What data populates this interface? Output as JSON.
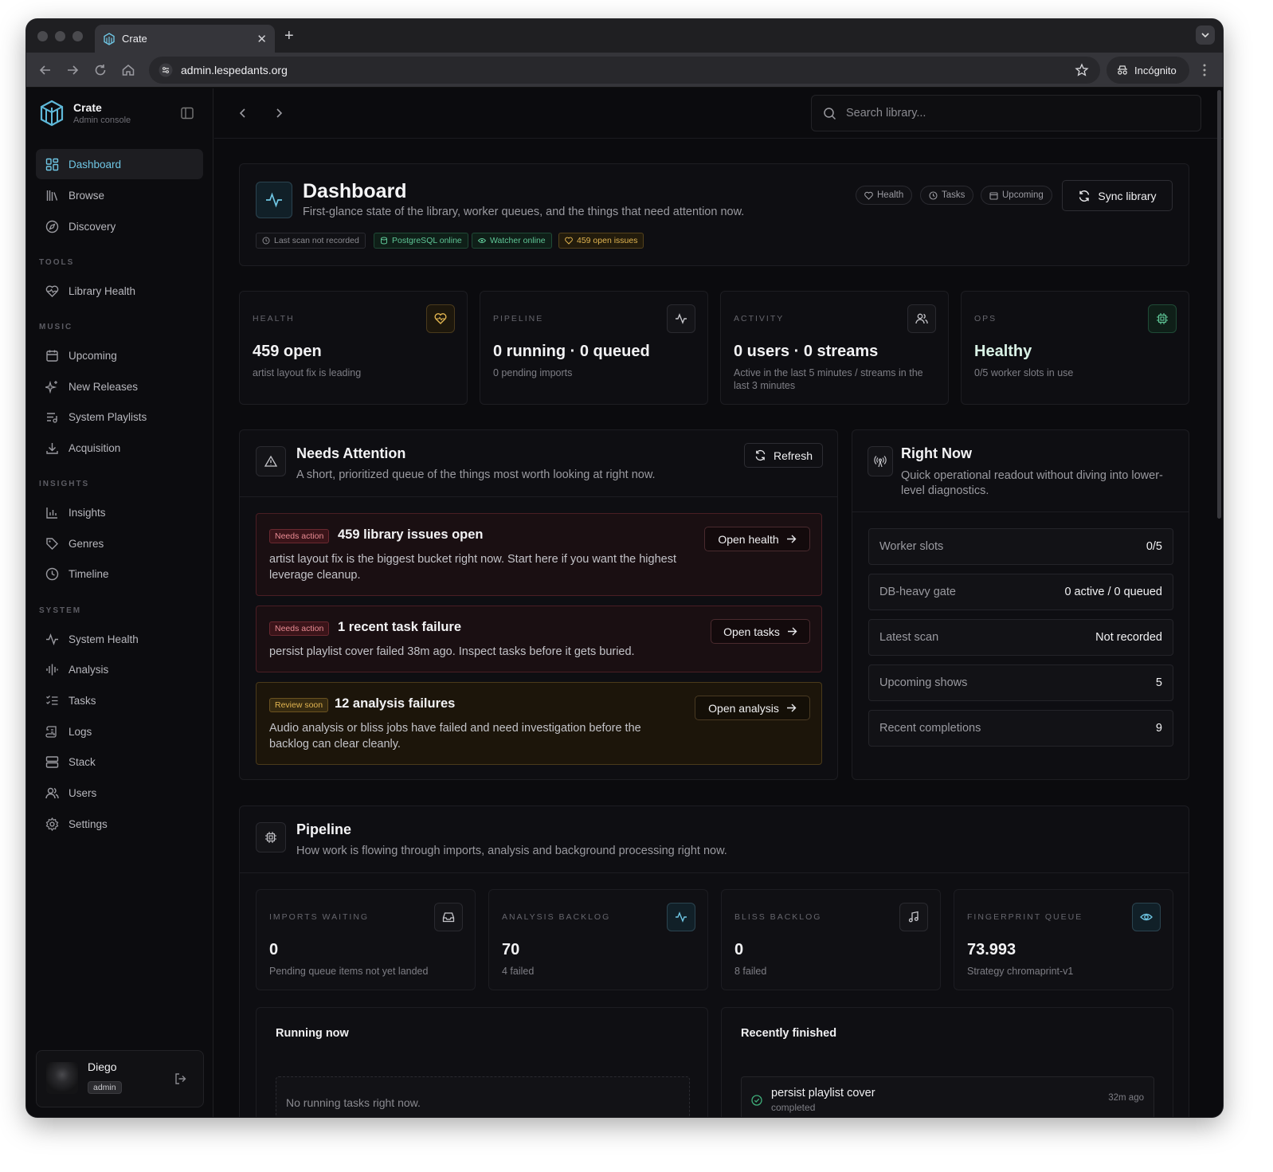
{
  "browser": {
    "tab_title": "Crate",
    "url": "admin.lespedants.org",
    "incognito_label": "Incógnito"
  },
  "sidebar": {
    "brand_name": "Crate",
    "brand_sub": "Admin console",
    "items_top": [
      {
        "label": "Dashboard",
        "icon": "grid-icon",
        "active": true
      },
      {
        "label": "Browse",
        "icon": "library-icon"
      },
      {
        "label": "Discovery",
        "icon": "compass-icon"
      }
    ],
    "sections": [
      {
        "title": "TOOLS",
        "items": [
          {
            "label": "Library Health",
            "icon": "heart-pulse-icon"
          }
        ]
      },
      {
        "title": "MUSIC",
        "items": [
          {
            "label": "Upcoming",
            "icon": "calendar-icon"
          },
          {
            "label": "New Releases",
            "icon": "sparkles-icon"
          },
          {
            "label": "System Playlists",
            "icon": "playlist-icon"
          },
          {
            "label": "Acquisition",
            "icon": "download-icon"
          }
        ]
      },
      {
        "title": "INSIGHTS",
        "items": [
          {
            "label": "Insights",
            "icon": "bar-chart-icon"
          },
          {
            "label": "Genres",
            "icon": "tag-icon"
          },
          {
            "label": "Timeline",
            "icon": "clock-icon"
          }
        ]
      },
      {
        "title": "SYSTEM",
        "items": [
          {
            "label": "System Health",
            "icon": "activity-icon"
          },
          {
            "label": "Analysis",
            "icon": "waveform-icon"
          },
          {
            "label": "Tasks",
            "icon": "list-checks-icon"
          },
          {
            "label": "Logs",
            "icon": "scroll-icon"
          },
          {
            "label": "Stack",
            "icon": "server-icon"
          },
          {
            "label": "Users",
            "icon": "users-icon"
          },
          {
            "label": "Settings",
            "icon": "gear-icon"
          }
        ]
      }
    ],
    "user": {
      "name": "Diego",
      "role": "admin"
    }
  },
  "topbar": {
    "search_placeholder": "Search library..."
  },
  "header": {
    "title": "Dashboard",
    "subtitle": "First-glance state of the library, worker queues, and the things that need attention now.",
    "pills": [
      "Health",
      "Tasks",
      "Upcoming"
    ],
    "sync_label": "Sync library",
    "chips": [
      {
        "label": "Last scan not recorded",
        "tone": "neutral"
      },
      {
        "label": "PostgreSQL online",
        "tone": "green"
      },
      {
        "label": "Watcher online",
        "tone": "green"
      },
      {
        "label": "459 open issues",
        "tone": "amber"
      }
    ]
  },
  "stats": [
    {
      "label": "HEALTH",
      "value": "459 open",
      "sub": "artist layout fix is leading",
      "icon": "heart-icon"
    },
    {
      "label": "PIPELINE",
      "value": "0 running · 0 queued",
      "sub": "0 pending imports",
      "icon": "activity-icon"
    },
    {
      "label": "ACTIVITY",
      "value": "0 users · 0 streams",
      "sub": "Active in the last 5 minutes / streams in the last 3 minutes",
      "icon": "users-icon"
    },
    {
      "label": "OPS",
      "value": "Healthy",
      "sub": "0/5 worker slots in use",
      "icon": "cpu-icon"
    }
  ],
  "attention": {
    "title": "Needs Attention",
    "subtitle": "A short, prioritized queue of the things most worth looking at right now.",
    "refresh_label": "Refresh",
    "items": [
      {
        "badge": "Needs action",
        "title": "459 library issues open",
        "desc": "artist layout fix is the biggest bucket right now. Start here if you want the highest leverage cleanup.",
        "action": "Open health",
        "tone": "red"
      },
      {
        "badge": "Needs action",
        "title": "1 recent task failure",
        "desc": "persist playlist cover failed 38m ago. Inspect tasks before it gets buried.",
        "action": "Open tasks",
        "tone": "red"
      },
      {
        "badge": "Review soon",
        "title": "12 analysis failures",
        "desc": "Audio analysis or bliss jobs have failed and need investigation before the backlog can clear cleanly.",
        "action": "Open analysis",
        "tone": "amber"
      }
    ]
  },
  "right_now": {
    "title": "Right Now",
    "subtitle": "Quick operational readout without diving into lower-level diagnostics.",
    "rows": [
      {
        "key": "Worker slots",
        "value": "0/5"
      },
      {
        "key": "DB-heavy gate",
        "value": "0 active / 0 queued"
      },
      {
        "key": "Latest scan",
        "value": "Not recorded"
      },
      {
        "key": "Upcoming shows",
        "value": "5"
      },
      {
        "key": "Recent completions",
        "value": "9"
      }
    ]
  },
  "pipeline": {
    "title": "Pipeline",
    "subtitle": "How work is flowing through imports, analysis and background processing right now.",
    "stats": [
      {
        "label": "IMPORTS WAITING",
        "value": "0",
        "sub": "Pending queue items not yet landed",
        "icon": "inbox-icon"
      },
      {
        "label": "ANALYSIS BACKLOG",
        "value": "70",
        "sub": "4 failed",
        "icon": "activity-icon"
      },
      {
        "label": "BLISS BACKLOG",
        "value": "0",
        "sub": "8 failed",
        "icon": "music-icon"
      },
      {
        "label": "FINGERPRINT QUEUE",
        "value": "73.993",
        "sub": "Strategy chromaprint-v1",
        "icon": "eye-icon"
      }
    ],
    "running_title": "Running now",
    "running_empty": "No running tasks right now.",
    "finished_title": "Recently finished",
    "finished": [
      {
        "name": "persist playlist cover",
        "status": "completed",
        "time": "32m ago"
      }
    ]
  },
  "colors": {
    "accent": "#6fc6e4",
    "green": "#3fae7a",
    "amber": "#d9a441",
    "red": "#d0505a"
  }
}
